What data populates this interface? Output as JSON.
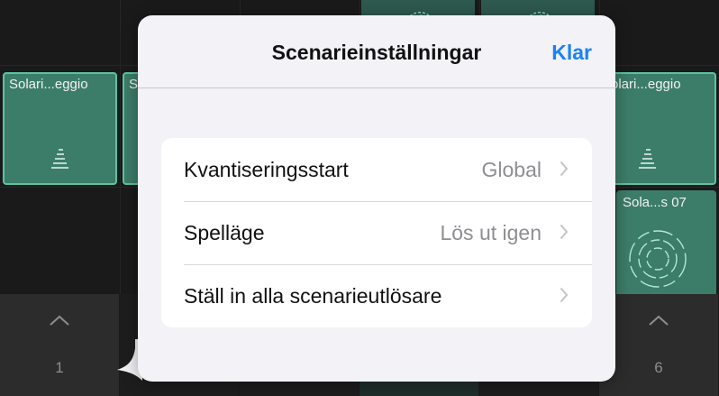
{
  "grid": {
    "cells": [
      {
        "label": "Solari...eggio",
        "icon": "waveform-spiral-icon"
      },
      {
        "label": "S",
        "icon": "waveform-spiral-icon"
      },
      {
        "label": "olari...eggio",
        "icon": "waveform-spiral-icon"
      },
      {
        "label": "Sola...s 07",
        "icon": "circular-waveform-icon"
      }
    ],
    "top_cells": [
      {
        "icon": "circular-waveform-icon"
      },
      {
        "icon": "circular-waveform-icon"
      }
    ]
  },
  "triggers": [
    {
      "number": "1",
      "icon": "chevron-up-icon"
    },
    {
      "number": "6",
      "icon": "chevron-up-icon"
    }
  ],
  "popover": {
    "title": "Scenarieinställningar",
    "done_label": "Klar",
    "rows": [
      {
        "label": "Kvantiseringsstart",
        "value": "Global"
      },
      {
        "label": "Spelläge",
        "value": "Lös ut igen"
      },
      {
        "label": "Ställ in alla scenarieutlösare",
        "value": ""
      }
    ]
  },
  "colors": {
    "accent": "#1a82f5",
    "cell_fill": "#3c7d69",
    "cell_border": "#5cc3a2",
    "background": "#1a1a1a"
  }
}
